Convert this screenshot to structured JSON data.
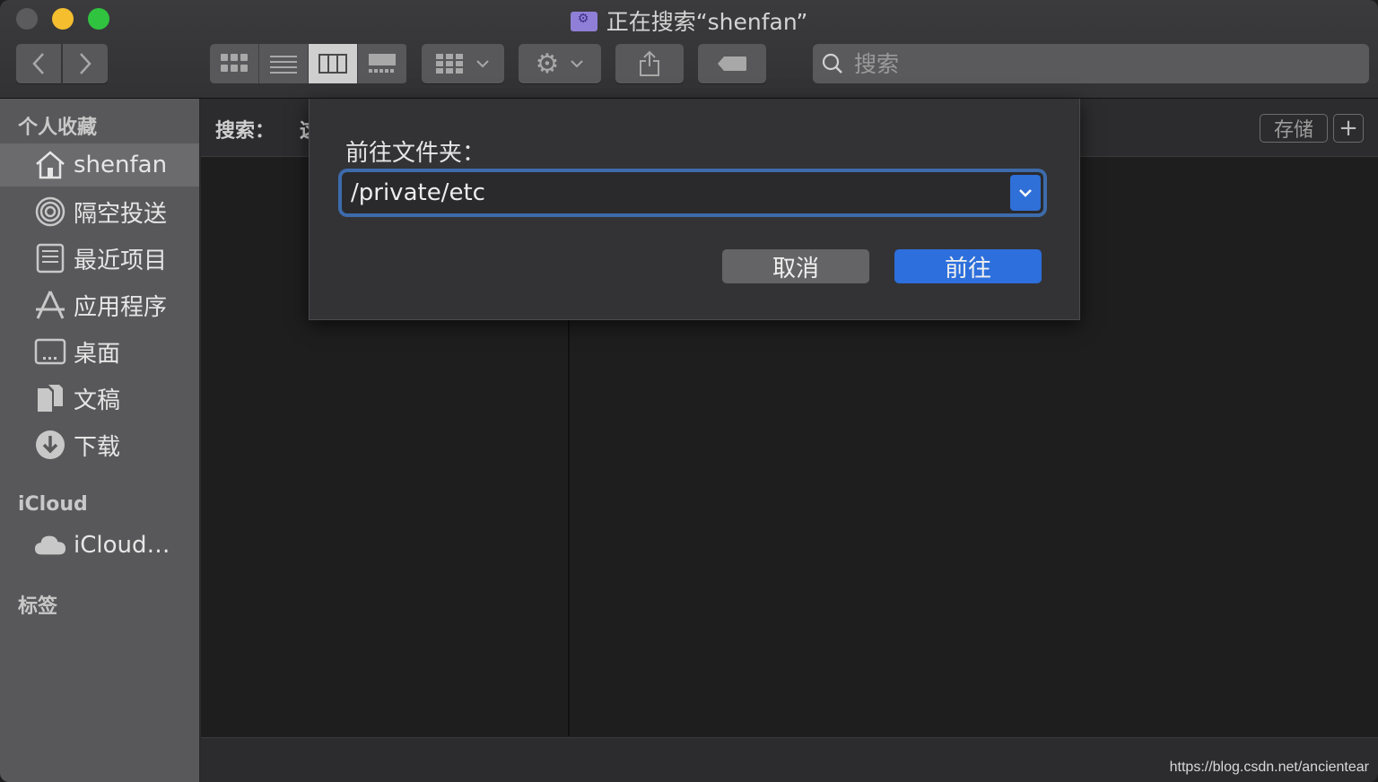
{
  "window": {
    "title": "正在搜索“shenfan”"
  },
  "toolbar": {
    "search_placeholder": "搜索"
  },
  "sidebar": {
    "favorites_header": "个人收藏",
    "items": [
      {
        "label": "shenfan",
        "icon": "home-icon"
      },
      {
        "label": "隔空投送",
        "icon": "airdrop-icon"
      },
      {
        "label": "最近项目",
        "icon": "recents-icon"
      },
      {
        "label": "应用程序",
        "icon": "applications-icon"
      },
      {
        "label": "桌面",
        "icon": "desktop-icon"
      },
      {
        "label": "文稿",
        "icon": "documents-icon"
      },
      {
        "label": "下载",
        "icon": "downloads-icon"
      }
    ],
    "icloud_header": "iCloud",
    "icloud_item": "iCloud…",
    "tags_header": "标签"
  },
  "searchbar": {
    "label": "搜索：",
    "scope_partial": "这",
    "save": "存储",
    "add": "+"
  },
  "dialog": {
    "prompt": "前往文件夹：",
    "path_value": "/private/etc",
    "cancel": "取消",
    "go": "前往"
  },
  "watermark": "https://blog.csdn.net/ancientear"
}
